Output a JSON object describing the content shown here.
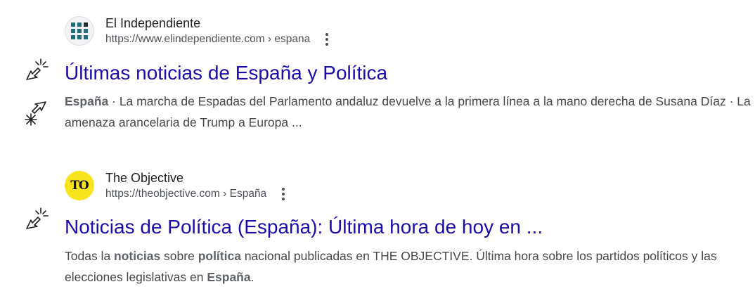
{
  "results": [
    {
      "site_name": "El Independiente",
      "url_text": "https://www.elindependiente.com › espana",
      "title": "Últimas noticias de España y Política",
      "snippet": {
        "bold_lead": "España",
        "sep": " · ",
        "text": "La marcha de Espadas del Parlamento andaluz devuelve a la primera línea a la mano derecha de Susana Díaz · La amenaza arancelaria de Trump a Europa ..."
      }
    },
    {
      "site_name": "The Objective",
      "favicon_text": "TO",
      "url_text": "https://theobjective.com › España",
      "title": "Noticias de Política (España): Última hora de hoy en ...",
      "snippet": {
        "t1": "Todas la ",
        "b1": "noticias",
        "t2": " sobre ",
        "b2": "política",
        "t3": " nacional publicadas en THE OBJECTIVE. Última hora sobre los partidos políticos y las elecciones legislativas en ",
        "b3": "España",
        "t4": "."
      }
    }
  ],
  "colors": {
    "title_link": "#1a0dab",
    "site_name": "#202124",
    "url": "#4d5156",
    "snippet": "#474747",
    "favicon_to_bg": "#f7e41a",
    "favicon_grid": "#1f6e7a"
  },
  "icons": {
    "favicon_1": "grid-logo-icon",
    "kebab": "more-vert-icon",
    "cursor": "click-cursor-icon"
  }
}
